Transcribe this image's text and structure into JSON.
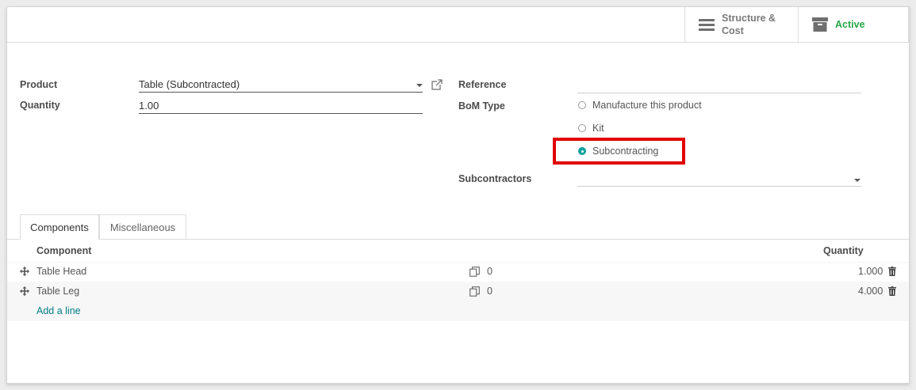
{
  "smart_buttons": {
    "structure_line1": "Structure &",
    "structure_line2": "Cost",
    "structure_icon": "list-bars-icon",
    "active_label": "Active",
    "active_icon": "archive-box-icon",
    "active_color": "#28a745"
  },
  "form": {
    "product_label": "Product",
    "product_value": "Table (Subcontracted)",
    "quantity_label": "Quantity",
    "quantity_value": "1.00",
    "reference_label": "Reference",
    "reference_value": "",
    "bom_type_label": "BoM Type",
    "bom_type_options": [
      {
        "label": "Manufacture this product",
        "checked": false
      },
      {
        "label": "Kit",
        "checked": false
      },
      {
        "label": "Subcontracting",
        "checked": true
      }
    ],
    "subcontractors_label": "Subcontractors",
    "subcontractors_value": ""
  },
  "tabs": [
    {
      "label": "Components",
      "active": true
    },
    {
      "label": "Miscellaneous",
      "active": false
    }
  ],
  "table": {
    "col_component": "Component",
    "col_quantity": "Quantity",
    "rows": [
      {
        "component": "Table Head",
        "copies": "0",
        "quantity": "1.000"
      },
      {
        "component": "Table Leg",
        "copies": "0",
        "quantity": "4.000"
      }
    ],
    "add_line": "Add a line"
  },
  "colors": {
    "accent": "#00a09d",
    "link": "#017e84",
    "highlight": "#e00000"
  }
}
